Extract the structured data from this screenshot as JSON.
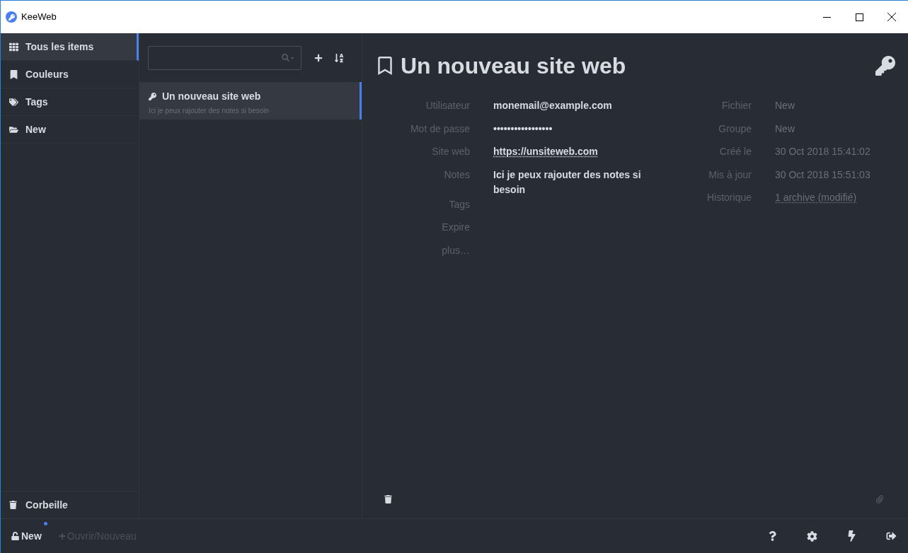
{
  "window": {
    "title": "KeeWeb"
  },
  "sidebar": {
    "items": [
      {
        "label": "Tous les items",
        "kind": "all",
        "selected": true
      },
      {
        "label": "Couleurs",
        "kind": "colors",
        "selected": false
      },
      {
        "label": "Tags",
        "kind": "tags",
        "selected": false
      },
      {
        "label": "New",
        "kind": "folder",
        "selected": false
      }
    ],
    "trash": {
      "label": "Corbeille"
    }
  },
  "list": {
    "entries": [
      {
        "title": "Un nouveau site web",
        "notes": "Ici je peux rajouter des notes si besoin",
        "selected": true
      }
    ]
  },
  "details": {
    "title": "Un nouveau site web",
    "fields": [
      {
        "label": "Utilisateur",
        "value": "monemail@example.com",
        "kind": "text"
      },
      {
        "label": "Mot de passe",
        "value": "•••••••••••••••••",
        "kind": "text"
      },
      {
        "label": "Site web",
        "value": "https://unsiteweb.com",
        "kind": "link"
      },
      {
        "label": "Notes",
        "value": "Ici je peux rajouter des notes si besoin",
        "kind": "text"
      },
      {
        "label": "Tags",
        "kind": "empty"
      },
      {
        "label": "Expire",
        "kind": "empty"
      },
      {
        "label": "plus…",
        "kind": "empty"
      }
    ],
    "meta": [
      {
        "label": "Fichier",
        "value": "New",
        "kind": "text"
      },
      {
        "label": "Groupe",
        "value": "New",
        "kind": "text"
      },
      {
        "label": "Créé le",
        "value": "30 Oct 2018 15:41:02",
        "kind": "text"
      },
      {
        "label": "Mis à jour",
        "value": "30 Oct 2018 15:51:03",
        "kind": "text"
      },
      {
        "label": "Historique",
        "value": "1 archive (modifié)",
        "kind": "link"
      }
    ]
  },
  "footer": {
    "file": {
      "label": "New",
      "modified": true
    },
    "open": {
      "label": "Ouvrir/Nouveau"
    }
  }
}
